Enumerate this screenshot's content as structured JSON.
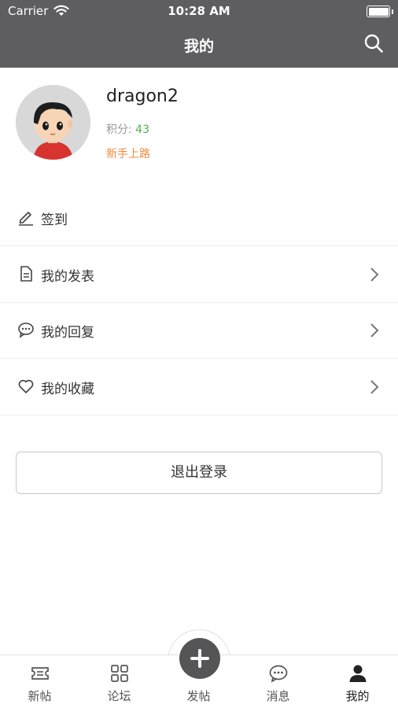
{
  "status_bar": {
    "carrier": "Carrier",
    "time": "10:28 AM"
  },
  "header": {
    "title": "我的"
  },
  "profile": {
    "username": "dragon2",
    "points_label": "积分: ",
    "points_value": "43",
    "level": "新手上路"
  },
  "menu": [
    {
      "label": "签到",
      "icon": "pencil-icon",
      "has_chevron": false
    },
    {
      "label": "我的发表",
      "icon": "document-icon",
      "has_chevron": true
    },
    {
      "label": "我的回复",
      "icon": "chat-bubble-icon",
      "has_chevron": true
    },
    {
      "label": "我的收藏",
      "icon": "heart-icon",
      "has_chevron": true
    }
  ],
  "logout_label": "退出登录",
  "tabbar": [
    {
      "label": "新帖",
      "icon": "ticket-icon"
    },
    {
      "label": "论坛",
      "icon": "grid-icon"
    },
    {
      "label": "发帖",
      "icon": "plus-icon"
    },
    {
      "label": "消息",
      "icon": "chat-bubble-icon"
    },
    {
      "label": "我的",
      "icon": "person-icon",
      "active": true
    }
  ],
  "colors": {
    "header_bg": "#5e5e60",
    "points_value": "#4caf50",
    "level": "#f08a3c"
  }
}
